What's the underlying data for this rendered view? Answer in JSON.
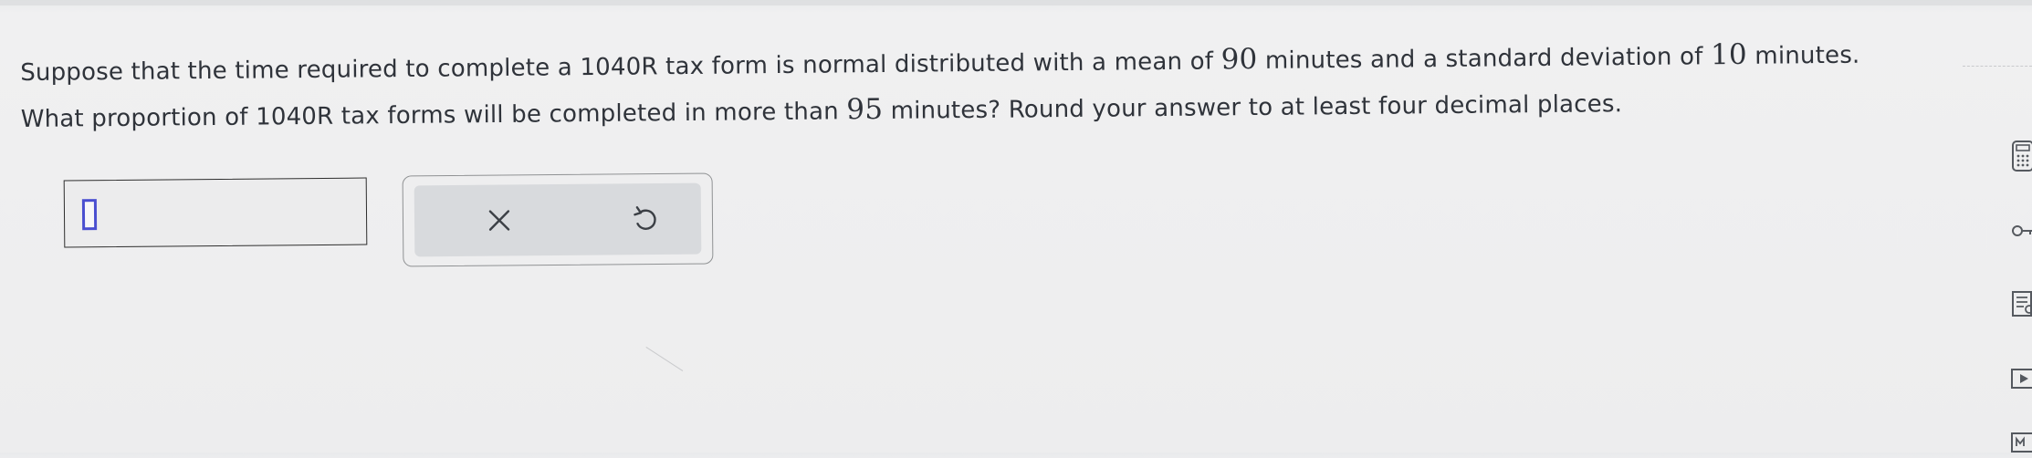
{
  "question": {
    "part1": "Suppose that the time required to complete a 1040R tax form is normal distributed with a mean of ",
    "mean": "90",
    "part2": " minutes and a standard deviation of ",
    "sd": "10",
    "part3": " minutes. What proportion of 1040R tax forms will be completed in more than ",
    "threshold": "95",
    "part4": " minutes? Round your answer to at least four decimal places."
  },
  "answer": {
    "value": ""
  },
  "buttons": {
    "clear_icon": "x-icon",
    "undo_icon": "undo-icon"
  },
  "toolbar": {
    "icons": [
      "calculator-icon",
      "key-icon",
      "textbook-icon",
      "video-icon",
      "ebook-icon"
    ]
  },
  "colors": {
    "cursor": "#4a4fd0",
    "panel": "#d8dadd",
    "background": "#ededee"
  }
}
